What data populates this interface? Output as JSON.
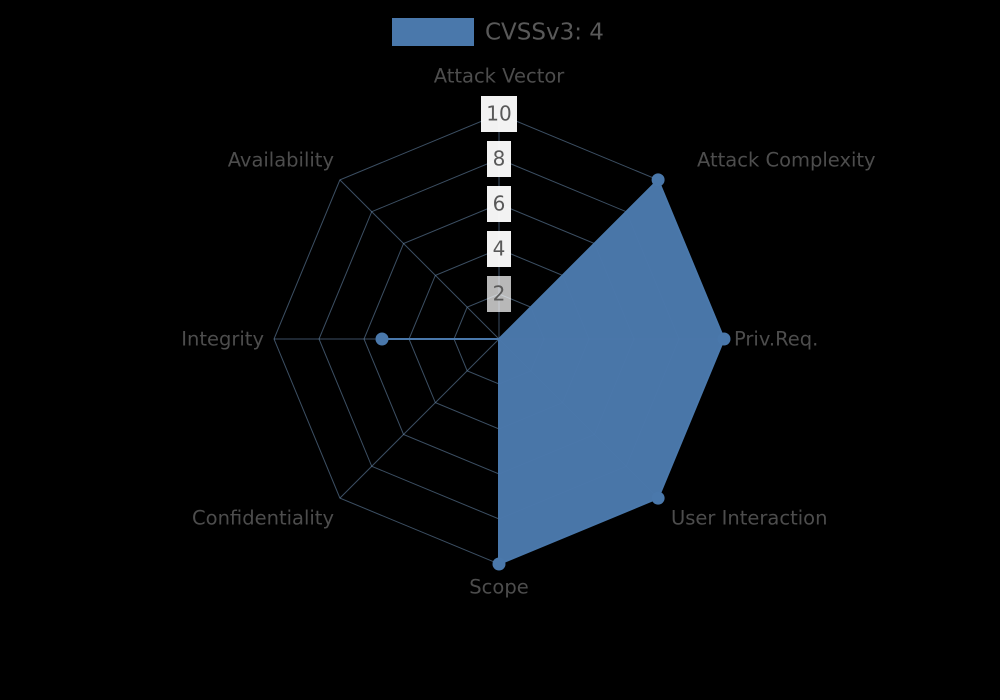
{
  "legend": {
    "entries": [
      {
        "label": "CVSSv3: 4",
        "color": "#4a78ab"
      }
    ]
  },
  "colors": {
    "series_fill": "#4a78ab",
    "series_stroke": "#4a78ab",
    "grid": "#6d8fb4",
    "spoke": "#6d8fb4",
    "background": "#000000",
    "label_text": "#4d4d4d",
    "tick_text": "#595959",
    "tick_box": "#ffffff"
  },
  "chart_data": {
    "type": "radar",
    "title": "",
    "subtitle": "",
    "xlabel": "",
    "ylabel": "",
    "grid": true,
    "legend_position": "top",
    "rlim": [
      0,
      10
    ],
    "tick_labels": [
      "2",
      "4",
      "6",
      "8",
      "10"
    ],
    "tick_values": [
      2,
      4,
      6,
      8,
      10
    ],
    "categories": [
      "Attack Vector",
      "Attack Complexity",
      "Priv.Req.",
      "User Interaction",
      "Scope",
      "Confidentiality",
      "Integrity",
      "Availability"
    ],
    "series": [
      {
        "name": "CVSSv3: 4",
        "color": "#4a78ab",
        "values": [
          0,
          10,
          10,
          10,
          10,
          0,
          5.2,
          0
        ]
      }
    ]
  }
}
